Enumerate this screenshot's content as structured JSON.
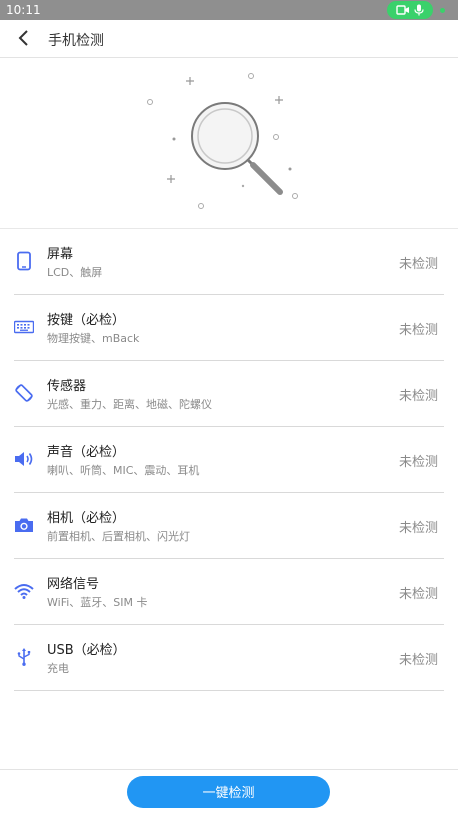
{
  "status_bar": {
    "time": "10:11"
  },
  "header": {
    "title": "手机检测"
  },
  "colors": {
    "accent": "#2196f3",
    "icon": "#4a6cf0"
  },
  "items": [
    {
      "icon": "phone-icon",
      "title": "屏幕",
      "subtitle": "LCD、触屏",
      "status": "未检测"
    },
    {
      "icon": "keyboard-icon",
      "title": "按键（必检）",
      "subtitle": "物理按键、mBack",
      "status": "未检测"
    },
    {
      "icon": "rotate-icon",
      "title": "传感器",
      "subtitle": "光感、重力、距离、地磁、陀螺仪",
      "status": "未检测"
    },
    {
      "icon": "speaker-icon",
      "title": "声音（必检）",
      "subtitle": "喇叭、听筒、MIC、震动、耳机",
      "status": "未检测"
    },
    {
      "icon": "camera-icon",
      "title": "相机（必检）",
      "subtitle": "前置相机、后置相机、闪光灯",
      "status": "未检测"
    },
    {
      "icon": "wifi-icon",
      "title": "网络信号",
      "subtitle": "WiFi、蓝牙、SIM 卡",
      "status": "未检测"
    },
    {
      "icon": "usb-icon",
      "title": "USB（必检）",
      "subtitle": "充电",
      "status": "未检测"
    }
  ],
  "footer": {
    "button_label": "一键检测"
  }
}
